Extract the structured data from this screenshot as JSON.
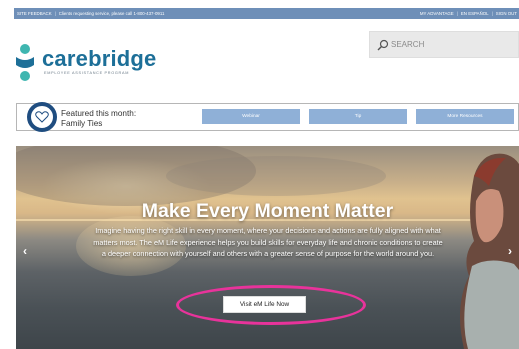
{
  "topbar": {
    "site_feedback": "SITE FEEDBACK",
    "service_notice": "Clients requesting service, please call 1-800-437-0911",
    "my_advantage": "MY ADVANTAGE",
    "espanol": "EN ESPAÑOL",
    "sign_out": "SIGN OUT"
  },
  "brand": {
    "name": "carebridge",
    "tagline": "EMPLOYEE ASSISTANCE PROGRAM",
    "colors": {
      "teal": "#3fb6b0",
      "blue": "#1d6f98"
    }
  },
  "search": {
    "placeholder": "SEARCH",
    "icon": "search-icon"
  },
  "featured": {
    "label_line1": "Featured this month:",
    "label_line2": "Family Ties",
    "icon": "heart-icon",
    "buttons": {
      "webinar": "Webinar",
      "tip": "Tip",
      "more_resources": "More Resources"
    }
  },
  "hero": {
    "title": "Make Every Moment Matter",
    "body": "Imagine having the right skill in every moment, where your decisions and actions are fully aligned with what matters most. The eM Life experience helps you build skills for everyday life and chronic conditions to create a deeper connection with yourself and others with a greater sense of purpose for the world around you.",
    "cta": "Visit eM Life Now",
    "prev_icon": "chevron-left-icon",
    "next_icon": "chevron-right-icon",
    "highlight_color": "#e8339b"
  }
}
